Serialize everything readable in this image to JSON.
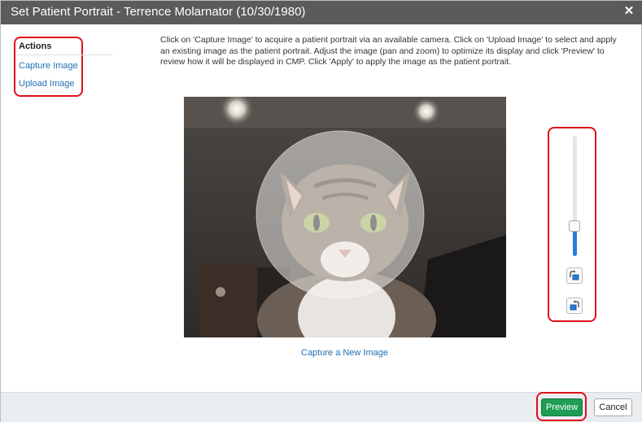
{
  "dialog": {
    "title": "Set Patient Portrait - Terrence Molarnator (10/30/1980)",
    "close_icon": "close-icon",
    "close_glyph": "✕"
  },
  "actions": {
    "heading": "Actions",
    "items": [
      {
        "label": "Capture Image"
      },
      {
        "label": "Upload Image"
      }
    ]
  },
  "instructions": "Click on 'Capture Image' to acquire a patient portrait via an available camera. Click on 'Upload Image' to select and apply an existing image as the patient portrait. Adjust the image (pan and zoom) to optimize its display and click 'Preview' to review how it will be displayed in CMP. Click 'Apply' to apply the image as the patient portrait.",
  "image": {
    "subject": "cat photo with circular crop overlay"
  },
  "capture_new_label": "Capture a New Image",
  "zoom": {
    "level_fraction": 0.25,
    "rotate_left_icon": "rotate-left-icon",
    "rotate_right_icon": "rotate-right-icon"
  },
  "footer": {
    "preview_label": "Preview",
    "cancel_label": "Cancel"
  },
  "colors": {
    "titlebar": "#5b5b5b",
    "link": "#1f6fb2",
    "highlight": "#e0101a",
    "preview_button": "#1f9d55",
    "slider_fill": "#2b7bd6"
  }
}
